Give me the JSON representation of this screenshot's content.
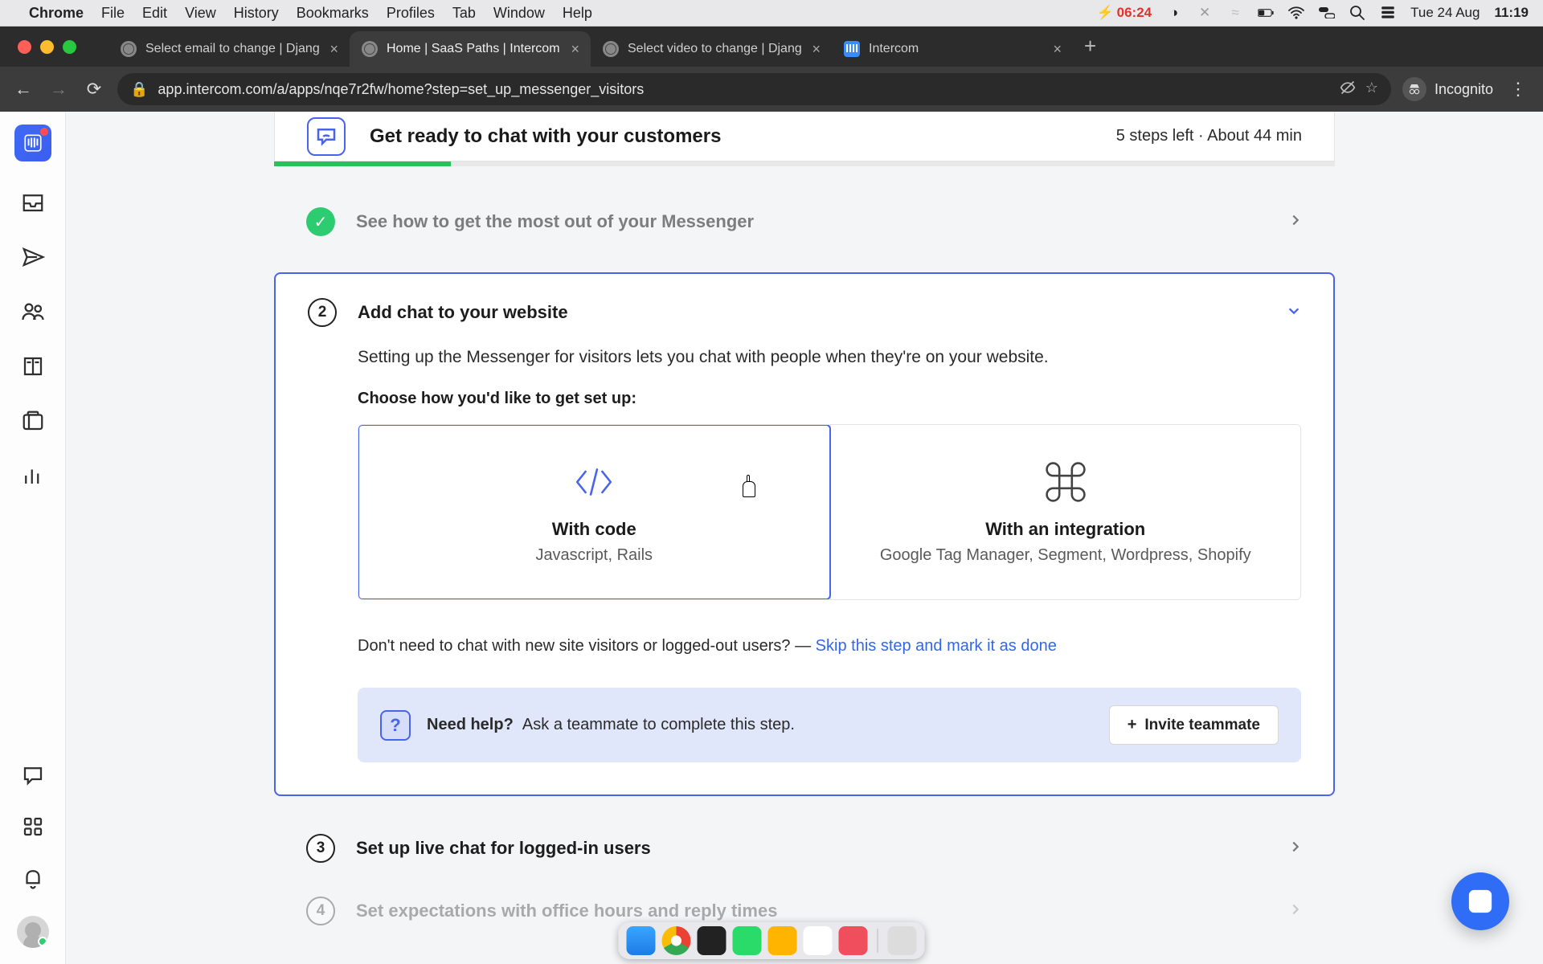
{
  "mac": {
    "app_name": "Chrome",
    "menus": [
      "File",
      "Edit",
      "View",
      "History",
      "Bookmarks",
      "Profiles",
      "Tab",
      "Window",
      "Help"
    ],
    "battery_warn": "06:24",
    "date": "Tue 24 Aug",
    "time": "11:19"
  },
  "tabs": [
    {
      "title": "Select email to change | Djang",
      "kind": "globe"
    },
    {
      "title": "Home | SaaS Paths | Intercom",
      "kind": "globe"
    },
    {
      "title": "Select video to change | Djang",
      "kind": "globe"
    },
    {
      "title": "Intercom",
      "kind": "intercom"
    }
  ],
  "active_tab_index": 1,
  "url": "app.intercom.com/a/apps/nqe7r2fw/home?step=set_up_messenger_visitors",
  "incognito_label": "Incognito",
  "header": {
    "title": "Get ready to chat with your customers",
    "meta": "5 steps left · About 44 min"
  },
  "step1": {
    "label": "See how to get the most out of your Messenger"
  },
  "step2": {
    "number": "2",
    "label": "Add chat to your website",
    "desc": "Setting up the Messenger for visitors lets you chat with people when they're on your website.",
    "choose": "Choose how you'd like to get set up:",
    "options": [
      {
        "title": "With code",
        "sub": "Javascript, Rails"
      },
      {
        "title": "With an integration",
        "sub": "Google Tag Manager, Segment, Wordpress, Shopify"
      }
    ],
    "skip_prefix": "Don't need to chat with new site visitors or logged-out users? — ",
    "skip_link": "Skip this step and mark it as done",
    "help_bold": "Need help?",
    "help_text": "Ask a teammate to complete this step.",
    "invite": "Invite teammate"
  },
  "step3": {
    "number": "3",
    "label": "Set up live chat for logged-in users"
  },
  "step4": {
    "number": "4",
    "label": "Set expectations with office hours and reply times"
  }
}
